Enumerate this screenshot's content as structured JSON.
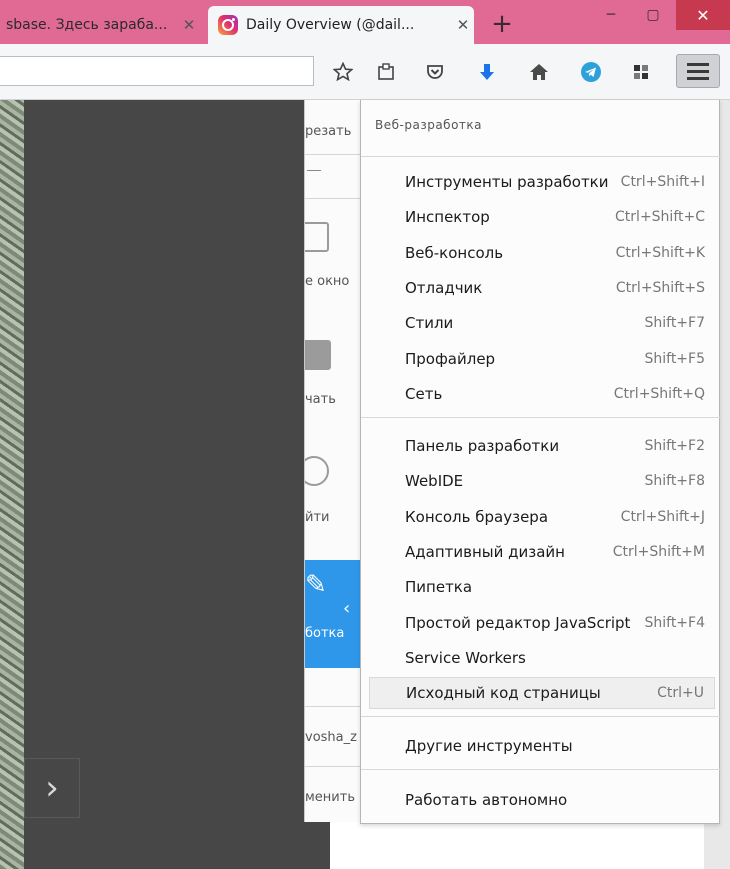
{
  "tabs": [
    {
      "title": "sbase. Здесь зараба...",
      "active": false
    },
    {
      "title": "Daily Overview (@dail...",
      "active": true
    }
  ],
  "new_tab_label": "+",
  "window": {
    "minimize": "─",
    "maximize": "▢",
    "close": "✕"
  },
  "toolbar": {
    "icons": [
      "bookmark-star-icon",
      "reading-list-icon",
      "pocket-icon",
      "download-icon",
      "home-icon",
      "telegram-icon",
      "extension-icon",
      "hamburger-menu-icon"
    ]
  },
  "panel": {
    "labels": [
      "резать",
      "е окно",
      "чать",
      "йти",
      "ботка",
      "vosha_z",
      "менить"
    ]
  },
  "submenu": {
    "header": "Веб-разработка",
    "groups": [
      [
        {
          "label": "Инструменты разработки",
          "shortcut": "Ctrl+Shift+I"
        },
        {
          "label": "Инспектор",
          "shortcut": "Ctrl+Shift+C"
        },
        {
          "label": "Веб-консоль",
          "shortcut": "Ctrl+Shift+K"
        },
        {
          "label": "Отладчик",
          "shortcut": "Ctrl+Shift+S"
        },
        {
          "label": "Стили",
          "shortcut": "Shift+F7"
        },
        {
          "label": "Профайлер",
          "shortcut": "Shift+F5"
        },
        {
          "label": "Сеть",
          "shortcut": "Ctrl+Shift+Q"
        }
      ],
      [
        {
          "label": "Панель разработки",
          "shortcut": "Shift+F2"
        },
        {
          "label": "WebIDE",
          "shortcut": "Shift+F8"
        },
        {
          "label": "Консоль браузера",
          "shortcut": "Ctrl+Shift+J"
        },
        {
          "label": "Адаптивный дизайн",
          "shortcut": "Ctrl+Shift+M"
        },
        {
          "label": "Пипетка",
          "shortcut": ""
        },
        {
          "label": "Простой редактор JavaScript",
          "shortcut": "Shift+F4"
        },
        {
          "label": "Service Workers",
          "shortcut": ""
        },
        {
          "label": "Исходный код страницы",
          "shortcut": "Ctrl+U",
          "highlighted": true
        }
      ],
      [
        {
          "label": "Другие инструменты",
          "shortcut": ""
        }
      ],
      [
        {
          "label": "Работать автономно",
          "shortcut": ""
        }
      ]
    ]
  }
}
